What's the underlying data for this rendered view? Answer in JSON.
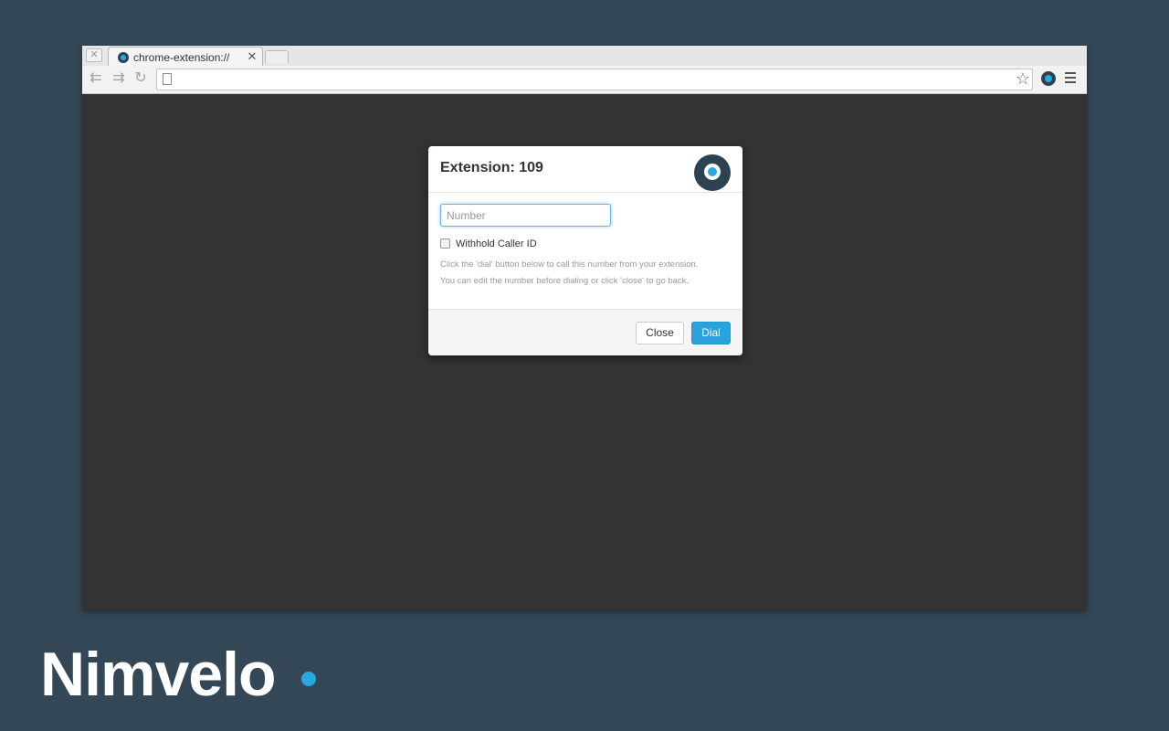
{
  "browser": {
    "tab": {
      "title": "chrome-extension://",
      "close_glyph": "✕"
    },
    "window_close_glyph": "✕",
    "icons": {
      "back": "back-arrow-icon",
      "forward": "forward-arrow-icon",
      "reload": "reload-icon",
      "bookmark": "star-icon",
      "extension": "extension-icon",
      "menu": "menu-icon"
    },
    "address": {
      "value": "",
      "placeholder": ""
    }
  },
  "dialog": {
    "title": "Extension: 109",
    "number_input": {
      "placeholder": "Number",
      "value": ""
    },
    "withhold_caller_id": {
      "label": "Withhold Caller ID",
      "checked": false
    },
    "help_line_1": "Click the 'dial' button below to call this number from your extension.",
    "help_line_2": "You can edit the number before dialing or click 'close' to go back.",
    "buttons": {
      "close": "Close",
      "dial": "Dial"
    }
  },
  "brand": {
    "name": "Nimvelo"
  },
  "colors": {
    "background": "#334756",
    "page": "#333333",
    "accent": "#2aa3dc",
    "logo_dark": "#2d4251"
  }
}
